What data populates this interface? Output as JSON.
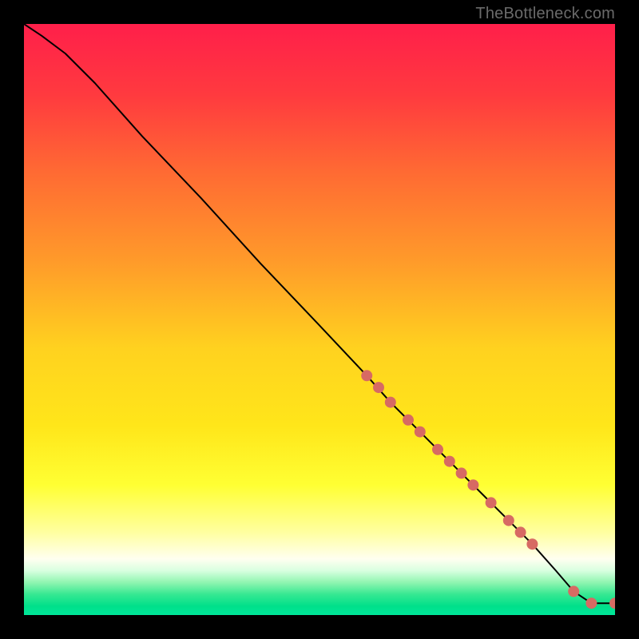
{
  "watermark": "TheBottleneck.com",
  "gradient_stops": [
    {
      "offset": 0.0,
      "color": "#ff1f4a"
    },
    {
      "offset": 0.12,
      "color": "#ff3a3f"
    },
    {
      "offset": 0.25,
      "color": "#ff6a33"
    },
    {
      "offset": 0.4,
      "color": "#ff9a2a"
    },
    {
      "offset": 0.55,
      "color": "#ffd21f"
    },
    {
      "offset": 0.68,
      "color": "#ffe61a"
    },
    {
      "offset": 0.78,
      "color": "#ffff33"
    },
    {
      "offset": 0.86,
      "color": "#ffffa0"
    },
    {
      "offset": 0.905,
      "color": "#fffff0"
    },
    {
      "offset": 0.925,
      "color": "#d8ffe0"
    },
    {
      "offset": 0.945,
      "color": "#8ff5b0"
    },
    {
      "offset": 0.965,
      "color": "#36e892"
    },
    {
      "offset": 0.985,
      "color": "#00e08a"
    },
    {
      "offset": 1.0,
      "color": "#00e69a"
    }
  ],
  "marker_color": "#d76a63",
  "chart_data": {
    "type": "line",
    "title": "",
    "xlabel": "",
    "ylabel": "",
    "xlim": [
      0,
      100
    ],
    "ylim": [
      0,
      100
    ],
    "series": [
      {
        "name": "curve",
        "x": [
          0,
          3,
          7,
          12,
          20,
          30,
          40,
          50,
          58,
          62,
          66,
          70,
          74,
          78,
          82,
          86,
          90,
          93,
          96,
          100
        ],
        "y": [
          100,
          98,
          95,
          90,
          81,
          70.5,
          59.5,
          49,
          40.5,
          36,
          32,
          28,
          24,
          20,
          16,
          12,
          7.5,
          4,
          2,
          2
        ]
      }
    ],
    "markers": {
      "name": "highlighted-points",
      "x": [
        58,
        60,
        62,
        65,
        67,
        70,
        72,
        74,
        76,
        79,
        82,
        84,
        86,
        93,
        96,
        100
      ],
      "y": [
        40.5,
        38.5,
        36,
        33,
        31,
        28,
        26,
        24,
        22,
        19,
        16,
        14,
        12,
        4,
        2,
        2
      ]
    }
  }
}
